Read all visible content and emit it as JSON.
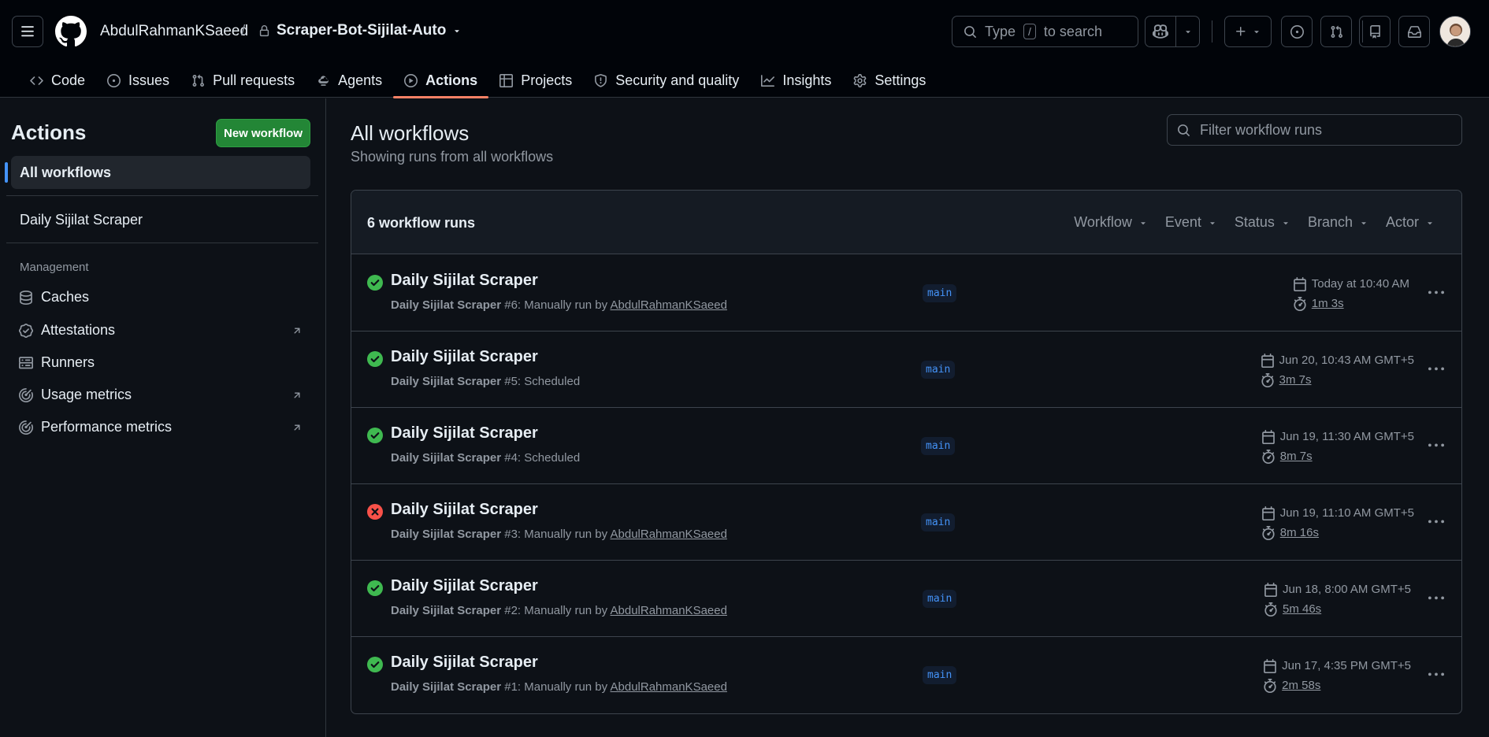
{
  "header": {
    "owner": "AbdulRahmanKSaeed",
    "separator": "/",
    "repo": "Scraper-Bot-Sijilat-Auto",
    "search_prefix": "Type",
    "search_key": "/",
    "search_suffix": "to search"
  },
  "nav": {
    "tabs": [
      {
        "label": "Code",
        "icon": "code-icon"
      },
      {
        "label": "Issues",
        "icon": "issue-icon"
      },
      {
        "label": "Pull requests",
        "icon": "pull-request-icon"
      },
      {
        "label": "Agents",
        "icon": "agents-icon"
      },
      {
        "label": "Actions",
        "icon": "play-icon",
        "active": true
      },
      {
        "label": "Projects",
        "icon": "table-icon"
      },
      {
        "label": "Security and quality",
        "icon": "shield-icon"
      },
      {
        "label": "Insights",
        "icon": "graph-icon"
      },
      {
        "label": "Settings",
        "icon": "gear-icon"
      }
    ]
  },
  "sidebar": {
    "title": "Actions",
    "new_workflow": "New workflow",
    "all_workflows": "All workflows",
    "workflow": "Daily Sijilat Scraper",
    "management_heading": "Management",
    "links": {
      "caches": "Caches",
      "attestations": "Attestations",
      "runners": "Runners",
      "usage": "Usage metrics",
      "performance": "Performance metrics"
    }
  },
  "main": {
    "title": "All workflows",
    "subtitle": "Showing runs from all workflows",
    "filter_placeholder": "Filter workflow runs",
    "count": "6 workflow runs",
    "filters": {
      "workflow": "Workflow",
      "event": "Event",
      "status": "Status",
      "branch": "Branch",
      "actor": "Actor"
    },
    "runs": [
      {
        "status": "success",
        "title": "Daily Sijilat Scraper",
        "workflow": "Daily Sijilat Scraper",
        "number": " #6: Manually run by ",
        "actor": "AbdulRahmanKSaeed",
        "branch": "main",
        "date": "Today at 10:40 AM",
        "duration": "1m 3s"
      },
      {
        "status": "success",
        "title": "Daily Sijilat Scraper",
        "workflow": "Daily Sijilat Scraper",
        "number": " #5: Scheduled",
        "actor": "",
        "branch": "main",
        "date": "Jun 20, 10:43 AM GMT+5",
        "duration": "3m 7s"
      },
      {
        "status": "success",
        "title": "Daily Sijilat Scraper",
        "workflow": "Daily Sijilat Scraper",
        "number": " #4: Scheduled",
        "actor": "",
        "branch": "main",
        "date": "Jun 19, 11:30 AM GMT+5",
        "duration": "8m 7s"
      },
      {
        "status": "failure",
        "title": "Daily Sijilat Scraper",
        "workflow": "Daily Sijilat Scraper",
        "number": " #3: Manually run by ",
        "actor": "AbdulRahmanKSaeed",
        "branch": "main",
        "date": "Jun 19, 11:10 AM GMT+5",
        "duration": "8m 16s"
      },
      {
        "status": "success",
        "title": "Daily Sijilat Scraper",
        "workflow": "Daily Sijilat Scraper",
        "number": " #2: Manually run by ",
        "actor": "AbdulRahmanKSaeed",
        "branch": "main",
        "date": "Jun 18, 8:00 AM GMT+5",
        "duration": "5m 46s"
      },
      {
        "status": "success",
        "title": "Daily Sijilat Scraper",
        "workflow": "Daily Sijilat Scraper",
        "number": " #1: Manually run by ",
        "actor": "AbdulRahmanKSaeed",
        "branch": "main",
        "date": "Jun 17, 4:35 PM GMT+5",
        "duration": "2m 58s"
      }
    ]
  },
  "colors": {
    "success": "#3fb950",
    "failure": "#f85149",
    "accent": "#f78166",
    "primary_button": "#238636"
  }
}
